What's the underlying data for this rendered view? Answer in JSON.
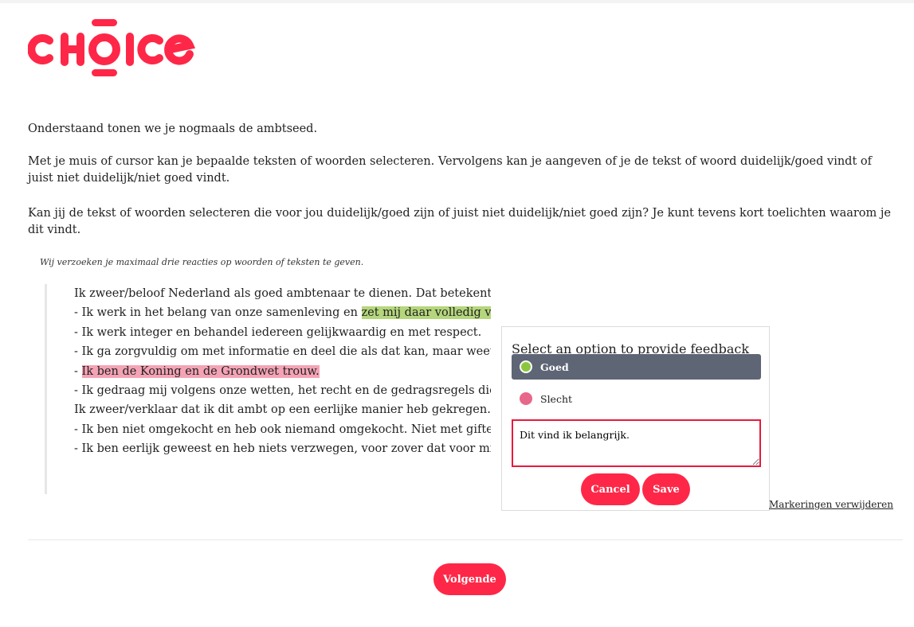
{
  "brand": {
    "logo_text": "CHOICE",
    "color": "#ff2747"
  },
  "intro": {
    "p1": "Onderstaand tonen we je nogmaals de ambtseed.",
    "p2": "Met je muis of cursor kan je bepaalde teksten of woorden selecteren. Vervolgens kan je aangeven of je de tekst of woord duidelijk/goed vindt of juist niet duidelijk/niet goed vindt.",
    "p3": "Kan jij de tekst of woorden selecteren die voor jou duidelijk/goed zijn of juist niet duidelijk/niet goed zijn? Je kunt tevens kort toelichten waarom je dit vindt.",
    "note": "Wij verzoeken je maximaal drie reacties op woorden of teksten te geven."
  },
  "oath": {
    "l1": "Ik zweer/beloof Nederland als goed ambtenaar te dienen. Dat betekent:",
    "l2_pre": "- Ik werk in het belang van onze samenleving en ",
    "l2_hl": "zet mij daar volledig voor in.",
    "l3": "- Ik werk integer en behandel iedereen gelijkwaardig en met respect.",
    "l4": "- Ik ga zorgvuldig om met informatie en deel die als dat kan, maar weet ook",
    "l5_pre": "- ",
    "l5_hl": "Ik ben de Koning en de Grondwet trouw.",
    "l6": "- Ik gedraag mij volgens onze wetten, het recht en de gedragsregels die verd",
    "l7": "Ik zweer/verklaar dat ik dit ambt op een eerlijke manier heb gekregen. Dat b",
    "l8": "- Ik ben niet omgekocht en heb ook niemand omgekocht. Niet met giften en",
    "l9": "- Ik ben eerlijk geweest en heb niets verzwegen, voor zover dat voor mijn we"
  },
  "feedback": {
    "title": "Select an option to provide feedback",
    "options": [
      {
        "label": "Goed",
        "color": "#8cc63f",
        "selected": true
      },
      {
        "label": "Slecht",
        "color": "#e7688a",
        "selected": false
      }
    ],
    "comment_value": "Dit vind ik belangrijk.",
    "cancel_label": "Cancel",
    "save_label": "Save"
  },
  "remove_markings_label": "Markeringen verwijderen",
  "next_label": "Volgende"
}
